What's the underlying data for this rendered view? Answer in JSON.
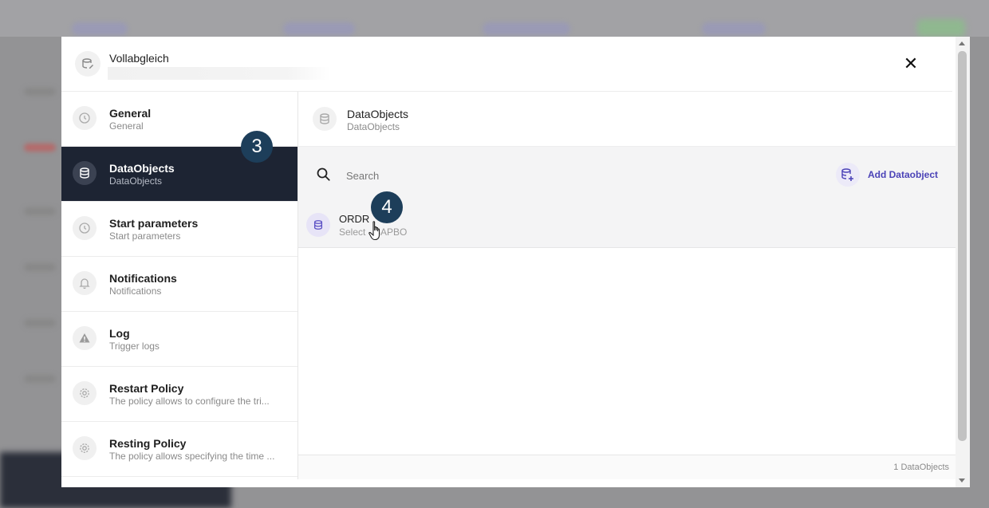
{
  "dialog": {
    "title": "Vollabgleich",
    "close_label": "✕"
  },
  "sidebar": {
    "items": [
      {
        "label": "General",
        "sub": "General",
        "icon": "clock-icon"
      },
      {
        "label": "DataObjects",
        "sub": "DataObjects",
        "icon": "database-icon",
        "active": true
      },
      {
        "label": "Start parameters",
        "sub": "Start parameters",
        "icon": "clock-icon"
      },
      {
        "label": "Notifications",
        "sub": "Notifications",
        "icon": "bell-icon"
      },
      {
        "label": "Log",
        "sub": "Trigger logs",
        "icon": "warning-icon"
      },
      {
        "label": "Restart Policy",
        "sub": "The policy allows to configure the tri...",
        "icon": "gear-icon"
      },
      {
        "label": "Resting Policy",
        "sub": "The policy allows specifying the time ...",
        "icon": "gear-icon"
      }
    ]
  },
  "content": {
    "title": "DataObjects",
    "subtitle": "DataObjects",
    "search_placeholder": "Search",
    "add_label": "Add Dataobject",
    "rows": [
      {
        "title": "ORDR",
        "sub": "Select - SAPBO"
      }
    ],
    "footer_count": "1 DataObjects"
  },
  "annotations": {
    "step_a": "3",
    "step_b": "4"
  },
  "colors": {
    "active_bg": "#1d2433",
    "accent": "#4b43b7",
    "badge": "#1d3e5a"
  }
}
